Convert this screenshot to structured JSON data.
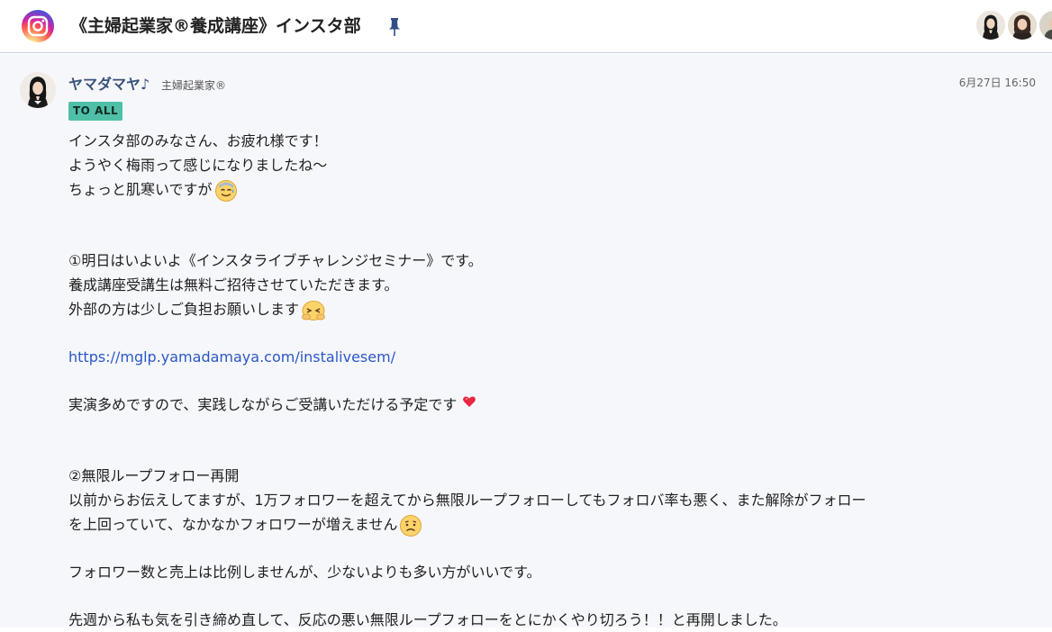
{
  "header": {
    "room_title": "《主婦起業家®養成講座》インスタ部",
    "avatar_count": 3
  },
  "message": {
    "sender_name": "ヤマダマヤ♪",
    "sender_org": "主婦起業家®",
    "timestamp": "6月27日 16:50",
    "badge": "TO ALL",
    "lines": {
      "l1": "インスタ部のみなさん、お疲れ様です！",
      "l2": "ようやく梅雨って感じになりましたね〜",
      "l3": "ちょっと肌寒いですが",
      "l4": "①明日はいよいよ《インスタライブチャレンジセミナー》です。",
      "l5": "養成講座受講生は無料ご招待させていただきます。",
      "l6": "外部の方は少しご負担お願いします",
      "link": "https://mglp.yamadamaya.com/instalivesem/",
      "l7": "実演多めですので、実践しながらご受講いただける予定です",
      "l8": "②無限ループフォロー再開",
      "l9": "以前からお伝えしてますが、1万フォロワーを超えてから無限ループフォローしてもフォロバ率も悪く、また解除がフォロー",
      "l10": "を上回っていて、なかなかフォロワーが増えません",
      "l11": "フォロワー数と売上は比例しませんが、少ないよりも多い方がいいです。",
      "l12": "先週から私も気を引き締め直して、反応の悪い無限ループフォローをとにかくやり切ろう！！と再開しました。"
    }
  },
  "icons": {
    "room_icon": "instagram-icon",
    "pin": "pin-icon",
    "emoji_1": "cold-sweat-smile-emoji",
    "emoji_2": "apologetic-bowing-emoji",
    "emoji_3": "red-heart-emoji",
    "emoji_4": "worried-face-emoji"
  },
  "colors": {
    "sender_name": "#38537a",
    "badge_bg": "#4fc0a7",
    "link": "#2b57c7",
    "timeline_bg": "#f6f7fa"
  }
}
